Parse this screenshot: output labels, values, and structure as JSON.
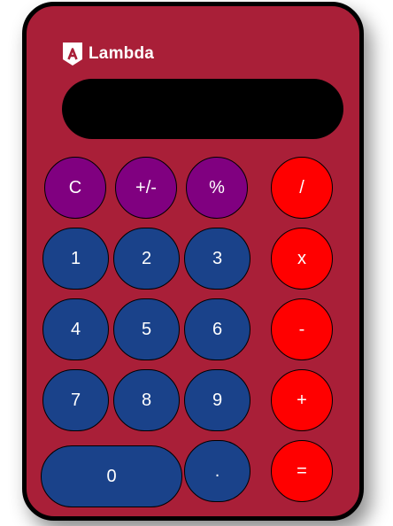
{
  "brand": {
    "name": "Lambda",
    "logo_icon": "lambda-logo-icon"
  },
  "display": {
    "value": ""
  },
  "colors": {
    "body": "#a91f38",
    "function_keys": "#800080",
    "number_keys": "#1a428a",
    "operator_keys": "#ff0000",
    "display": "#000000"
  },
  "keys": {
    "clear": "C",
    "sign": "+/-",
    "percent": "%",
    "divide": "/",
    "one": "1",
    "two": "2",
    "three": "3",
    "multiply": "x",
    "four": "4",
    "five": "5",
    "six": "6",
    "subtract": "-",
    "seven": "7",
    "eight": "8",
    "nine": "9",
    "add": "+",
    "zero": "0",
    "decimal": ".",
    "equals": "="
  }
}
